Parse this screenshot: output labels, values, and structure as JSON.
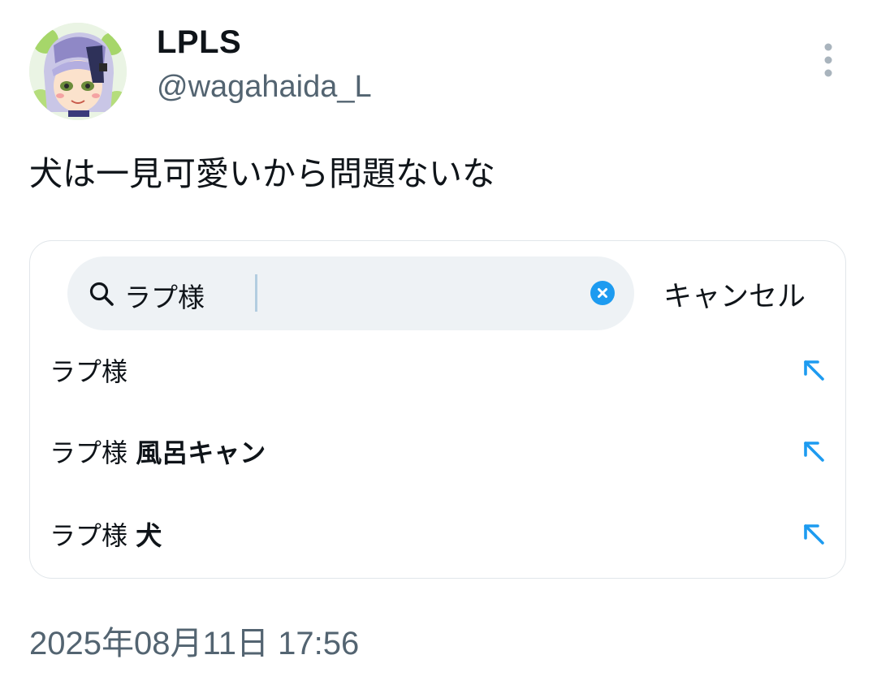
{
  "user": {
    "display_name": "LPLS",
    "handle": "@wagahaida_L"
  },
  "tweet": {
    "text": "犬は一見可愛いから問題ないな",
    "timestamp": "2025年08月11日 17:56"
  },
  "embedded_screenshot": {
    "search": {
      "query": "ラプ様",
      "cancel_label": "キャンセル"
    },
    "suggestions": [
      {
        "prefix": "ラプ様",
        "suffix": ""
      },
      {
        "prefix": "ラプ様",
        "suffix": "風呂キャン"
      },
      {
        "prefix": "ラプ様",
        "suffix": "犬"
      }
    ]
  },
  "icons": {
    "more": "more-vertical-icon",
    "search": "search-icon",
    "clear": "clear-icon",
    "suggestion_arrow": "arrow-up-left-icon"
  },
  "colors": {
    "accent": "#1d9bf0",
    "secondary_text": "#536471"
  }
}
